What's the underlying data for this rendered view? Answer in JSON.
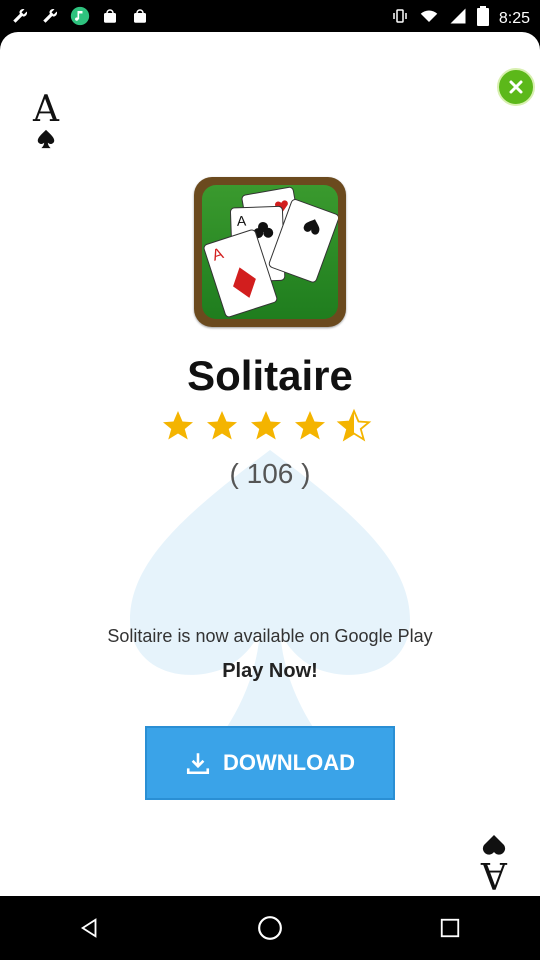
{
  "status_bar": {
    "time": "8:25",
    "left_icons": [
      "wrench-icon",
      "wrench-icon",
      "music-icon",
      "bag-icon",
      "bag-icon"
    ],
    "right_icons": [
      "vibrate-icon",
      "wifi-icon",
      "signal-icon",
      "battery-icon"
    ]
  },
  "ad": {
    "title": "Solitaire",
    "rating_stars": 4.5,
    "rating_count": "( 106 )",
    "description": "Solitaire is now available on Google Play",
    "cta_text": "Play Now!",
    "download_label": "DOWNLOAD",
    "corner_letter": "A",
    "accent_color": "#3aa3e8",
    "close_color": "#5cb81a"
  },
  "nav_bar": {
    "buttons": [
      "back-icon",
      "home-icon",
      "recents-icon"
    ]
  }
}
